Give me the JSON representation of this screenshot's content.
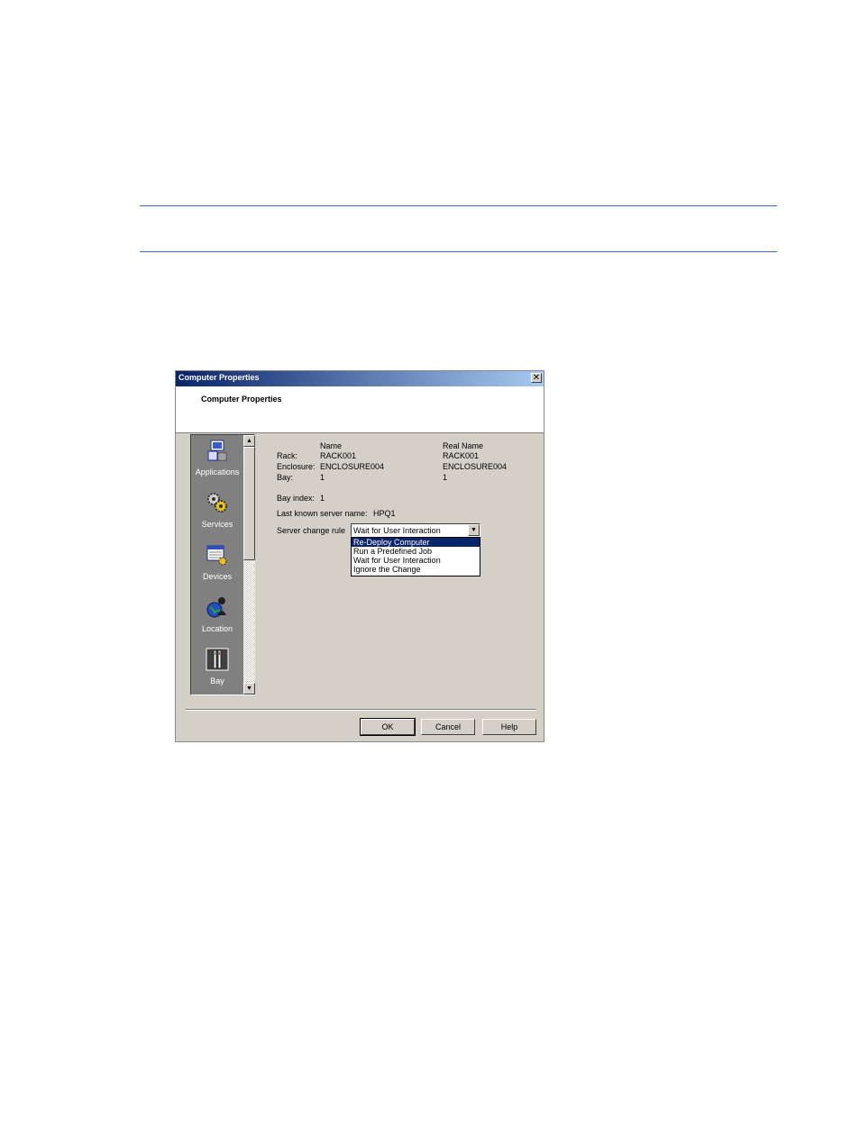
{
  "dialog": {
    "title": "Computer Properties",
    "close_glyph": "✕",
    "header_title": "Computer Properties"
  },
  "nav": {
    "items": [
      {
        "label": "Applications",
        "icon": "applications-icon"
      },
      {
        "label": "Services",
        "icon": "services-icon"
      },
      {
        "label": "Devices",
        "icon": "devices-icon"
      },
      {
        "label": "Location",
        "icon": "location-icon"
      },
      {
        "label": "Bay",
        "icon": "bay-icon"
      }
    ],
    "scroll_up": "▲",
    "scroll_down": "▼"
  },
  "properties": {
    "name_header": "Name",
    "real_name_header": "Real Name",
    "rows": [
      {
        "label": "Rack:",
        "name": "RACK001",
        "real_name": "RACK001"
      },
      {
        "label": "Enclosure:",
        "name": "ENCLOSURE004",
        "real_name": "ENCLOSURE004"
      },
      {
        "label": "Bay:",
        "name": "1",
        "real_name": "1"
      }
    ],
    "bay_index_label": "Bay index:",
    "bay_index_value": "1",
    "last_server_label": "Last known server name:",
    "last_server_value": "HPQ1",
    "change_rule_label": "Server change rule",
    "change_rule_value": "Wait for User Interaction",
    "dropdown_arrow": "▼",
    "change_rule_options": [
      "Re-Deploy Computer",
      "Run a Predefined Job",
      "Wait for User Interaction",
      "Ignore the Change"
    ]
  },
  "buttons": {
    "ok": "OK",
    "cancel": "Cancel",
    "help": "Help"
  }
}
